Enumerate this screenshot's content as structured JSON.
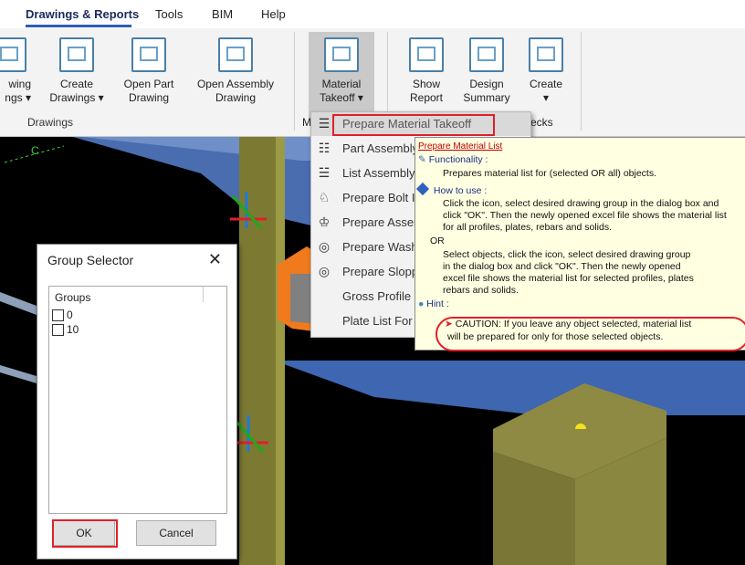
{
  "ribbon": {
    "tabs": [
      {
        "label": "Drawings & Reports",
        "active": true
      },
      {
        "label": "Tools"
      },
      {
        "label": "BIM"
      },
      {
        "label": "Help"
      }
    ],
    "buttons": [
      {
        "line1": "wing",
        "line2": "ngs ▾",
        "icon": "drawing-icon"
      },
      {
        "line1": "Create",
        "line2": "Drawings ▾",
        "icon": "create-drawings-icon"
      },
      {
        "line1": "Open Part",
        "line2": "Drawing",
        "icon": "open-part-drawing-icon"
      },
      {
        "line1": "Open Assembly",
        "line2": "Drawing",
        "icon": "open-assembly-drawing-icon"
      },
      {
        "line1": "Material",
        "line2": "Takeoff ▾",
        "icon": "material-takeoff-icon"
      },
      {
        "line1": "Show",
        "line2": "Report",
        "icon": "show-report-icon"
      },
      {
        "line1": "Design",
        "line2": "Summary",
        "icon": "design-summary-icon"
      },
      {
        "line1": "Create",
        "line2": "▾",
        "icon": "create-icon"
      }
    ],
    "group_label": "Drawings",
    "partial_labels": {
      "m": "M",
      "checks": "ecks"
    }
  },
  "dropdown": {
    "items": [
      {
        "icon": "☰",
        "label": "Prepare Material Takeoff"
      },
      {
        "icon": "☷",
        "label": "Part Assembly"
      },
      {
        "icon": "☱",
        "label": "List Assembly"
      },
      {
        "icon": "♘",
        "label": "Prepare Bolt I"
      },
      {
        "icon": "♔",
        "label": "Prepare Asser"
      },
      {
        "icon": "◎",
        "label": "Prepare Wash"
      },
      {
        "icon": "◎",
        "label": "Prepare Slopp"
      },
      {
        "icon": "",
        "label": "Gross Profile"
      },
      {
        "icon": "",
        "label": "Plate List For"
      }
    ]
  },
  "tooltip": {
    "title": "Prepare Material List",
    "functionality_header": "Functionality :",
    "functionality_text": "Prepares material list for (selected OR all) objects.",
    "how_header": "How to use :",
    "how_lines": [
      "Click the icon, select desired drawing group in the dialog box and",
      "click \"OK\". Then the newly opened excel file shows the material list",
      "for all profiles, plates, rebars and solids."
    ],
    "or_label": "OR",
    "how_lines2": [
      "Select objects, click the icon, select desired drawing group",
      "in the dialog box and click \"OK\". Then the newly opened",
      "excel file shows the material list for selected profiles, plates",
      "rebars and solids."
    ],
    "hint_header": "Hint :",
    "caution_line1": "CAUTION: If you leave any object selected, material list",
    "caution_line2": "will be prepared for only for those selected objects."
  },
  "dialog": {
    "title": "Group Selector",
    "close": "✕",
    "column_header": "Groups",
    "groups": [
      "0",
      "10"
    ],
    "ok_label": "OK",
    "cancel_label": "Cancel"
  },
  "viewport": {
    "axis_label": "C"
  },
  "colors": {
    "accent": "#2e5cb8",
    "highlight": "#e0202a",
    "tooltip_bg": "#ffffe1"
  }
}
